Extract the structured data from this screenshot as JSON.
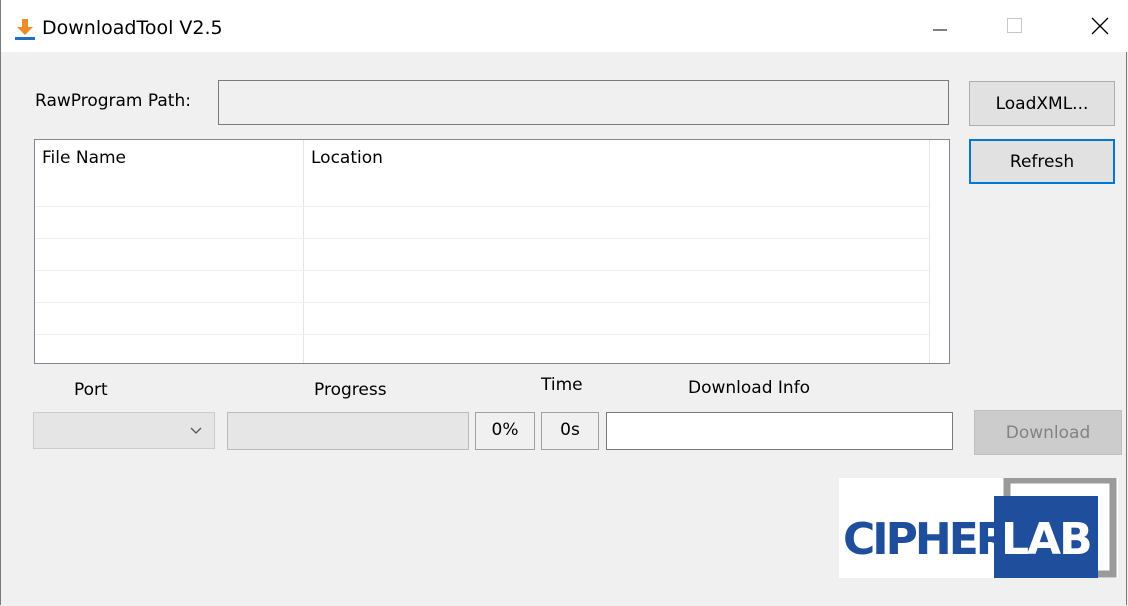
{
  "window": {
    "title": "DownloadTool V2.5"
  },
  "rawprogram": {
    "label": "RawProgram Path:",
    "value": ""
  },
  "buttons": {
    "load_xml": "LoadXML...",
    "refresh": "Refresh",
    "download": "Download"
  },
  "file_list": {
    "columns": [
      "File Name",
      "Location"
    ],
    "rows": []
  },
  "download_panel": {
    "port_label": "Port",
    "progress_label": "Progress",
    "time_label": "Time",
    "info_label": "Download Info",
    "port_selected": "",
    "progress_percent": "0%",
    "progress_value": 0,
    "time_value": "0s",
    "download_info": ""
  },
  "logo": {
    "text_left": "CIPHER",
    "text_right": "LAB",
    "colors": {
      "brand_blue": "#1f4e9c",
      "frame_gray": "#9a9a9a"
    }
  },
  "colors": {
    "focus_border": "#0078d7",
    "app_icon_orange": "#f08c28"
  }
}
